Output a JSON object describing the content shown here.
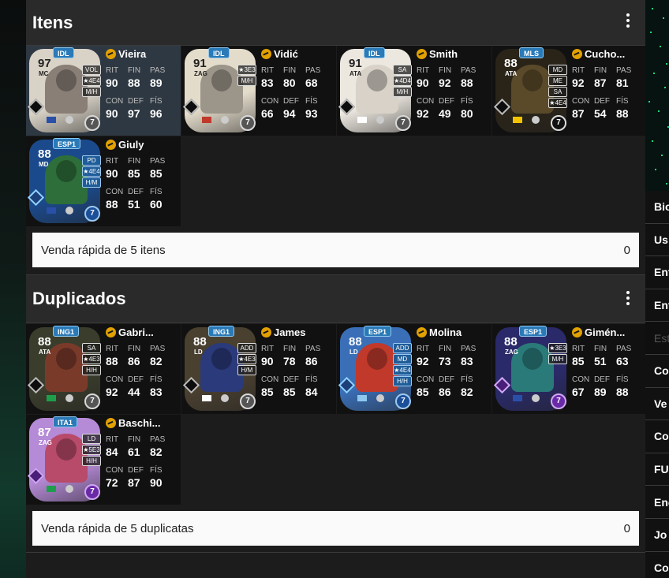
{
  "sections": {
    "items": {
      "title": "Itens",
      "quick_sell_label": "Venda rápida de 5 itens",
      "quick_sell_value": "0",
      "players": [
        {
          "name": "Vieira",
          "rating": "97",
          "pos": "MC",
          "badge": "IDL",
          "alt": [
            "VOL",
            "★4E4",
            "M/H"
          ],
          "stats": [
            "90",
            "88",
            "89",
            "97",
            "96"
          ],
          "stats_pac_con": [
            "90"
          ],
          "level": "7",
          "flag": "#2a4fa8",
          "card_color": "#d9d3c7",
          "ph_color": "#8a7f76",
          "gem": ""
        },
        {
          "name": "Vidić",
          "rating": "91",
          "pos": "ZAG",
          "badge": "IDL",
          "alt": [
            "★3E3",
            "M/H"
          ],
          "stats": [
            "83",
            "80",
            "68",
            "66",
            "94",
            "93"
          ],
          "level": "7",
          "flag": "#c0392b",
          "card_color": "#e4dccb",
          "ph_color": "#9c958a",
          "gem": ""
        },
        {
          "name": "Smith",
          "rating": "91",
          "pos": "ATA",
          "badge": "IDL",
          "alt": [
            "SA",
            "★4D4",
            "M/H"
          ],
          "stats": [
            "90",
            "92",
            "88",
            "92",
            "49",
            "80"
          ],
          "level": "7",
          "flag": "#ffffff",
          "card_color": "#ece7df",
          "ph_color": "#d8d2c8",
          "gem": ""
        },
        {
          "name": "Cucho...",
          "rating": "88",
          "pos": "ATA",
          "badge": "MLS",
          "alt": [
            "MD",
            "ME",
            "SA",
            "★4E4"
          ],
          "stats": [
            "92",
            "87",
            "81",
            "87",
            "54",
            "88"
          ],
          "level": "7",
          "flag": "#f3c300",
          "card_color": "#2a2418",
          "ph_color": "#5a4a2a",
          "gem": ""
        },
        {
          "name": "Giuly",
          "rating": "88",
          "pos": "MD",
          "badge": "ESP1",
          "alt": [
            "PD",
            "★4E4",
            "H/M"
          ],
          "stats": [
            "90",
            "85",
            "85",
            "88",
            "51",
            "60"
          ],
          "level": "7",
          "flag": "#2a4fa8",
          "card_color": "#1b4a8c",
          "ph_color": "#2d6e3a",
          "gem": "blue"
        }
      ]
    },
    "duplicates": {
      "title": "Duplicados",
      "quick_sell_label": "Venda rápida de 5 duplicatas",
      "quick_sell_value": "0",
      "players": [
        {
          "name": "Gabri...",
          "rating": "88",
          "pos": "ATA",
          "badge": "ING1",
          "alt": [
            "SA",
            "★4E3",
            "H/H"
          ],
          "stats": [
            "88",
            "86",
            "82",
            "92",
            "44",
            "83"
          ],
          "level": "7",
          "flag": "#1e9e4a",
          "card_color": "#3a3d2c",
          "ph_color": "#7a3a2a",
          "gem": ""
        },
        {
          "name": "James",
          "rating": "88",
          "pos": "LD",
          "badge": "ING1",
          "alt": [
            "ADD",
            "★4E3",
            "H/M"
          ],
          "stats": [
            "90",
            "78",
            "86",
            "85",
            "85",
            "84"
          ],
          "level": "7",
          "flag": "#ffffff",
          "card_color": "#4a4030",
          "ph_color": "#2a3a7a",
          "gem": ""
        },
        {
          "name": "Molina",
          "rating": "88",
          "pos": "LD",
          "badge": "ESP1",
          "alt": [
            "ADD",
            "MD",
            "★4E4",
            "H/H"
          ],
          "stats": [
            "92",
            "73",
            "83",
            "85",
            "86",
            "82"
          ],
          "level": "7",
          "flag": "#8ec8ef",
          "card_color": "#3a6fb8",
          "ph_color": "#c0392b",
          "gem": "blue"
        },
        {
          "name": "Gimén...",
          "rating": "88",
          "pos": "ZAG",
          "badge": "ESP1",
          "alt": [
            "★3E3",
            "M/H"
          ],
          "stats": [
            "85",
            "51",
            "63",
            "67",
            "89",
            "88"
          ],
          "level": "7",
          "flag": "#2a4fa8",
          "card_color": "#2a2a6a",
          "ph_color": "#2a7a7a",
          "gem": "purple"
        },
        {
          "name": "Baschi...",
          "rating": "87",
          "pos": "ZAG",
          "badge": "ITA1",
          "alt": [
            "LD",
            "★5E3",
            "H/H"
          ],
          "stats": [
            "84",
            "61",
            "82",
            "72",
            "87",
            "90"
          ],
          "level": "7",
          "flag": "#1e9e4a",
          "card_color": "#b58ad6",
          "ph_color": "#b84a6a",
          "gem": "purple"
        }
      ]
    }
  },
  "stat_labels": [
    "RIT",
    "FIN",
    "PAS",
    "CON",
    "DEF",
    "FÍS"
  ],
  "right_menu": [
    "Bio",
    "Us",
    "Ent",
    "Ent",
    "Est",
    "Co",
    "Ve",
    "Co",
    "FU",
    "Ene",
    "Jo",
    "Co"
  ]
}
